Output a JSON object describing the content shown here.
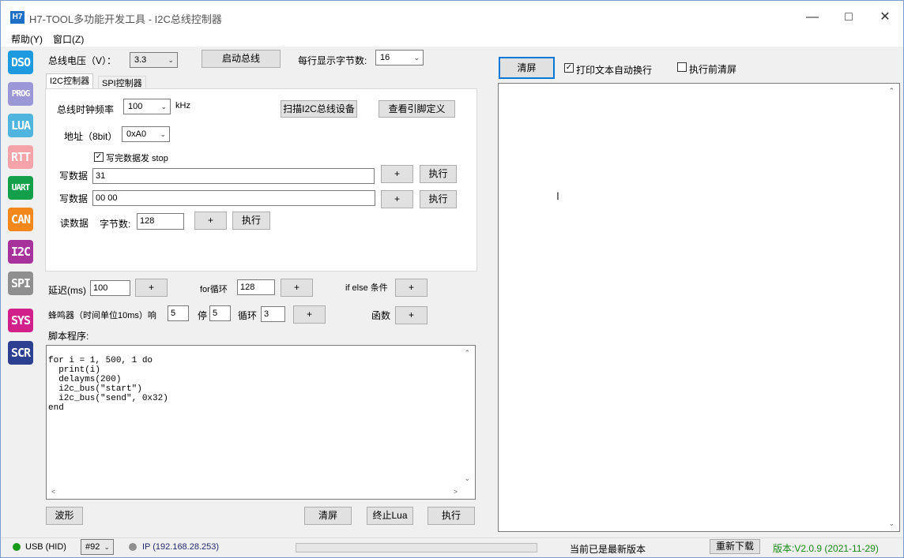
{
  "window": {
    "title": "H7-TOOL多功能开发工具 - I2C总线控制器",
    "icon_text": "H7"
  },
  "menu": {
    "items": [
      "帮助(Y)",
      "窗口(Z)"
    ]
  },
  "sidebar": {
    "items": [
      {
        "label": "DSO",
        "color": "#1e9be0"
      },
      {
        "label": "PROG",
        "color": "#9b96d6"
      },
      {
        "label": "LUA",
        "color": "#4fb4de"
      },
      {
        "label": "RTT",
        "color": "#f4a3a8"
      },
      {
        "label": "UART",
        "color": "#14a04a"
      },
      {
        "label": "CAN",
        "color": "#f2871c"
      },
      {
        "label": "I2C",
        "color": "#a8329c"
      },
      {
        "label": "SPI",
        "color": "#8f8f8f"
      },
      {
        "label": "SYS",
        "color": "#d2208a"
      },
      {
        "label": "SCR",
        "color": "#2c3f90"
      }
    ]
  },
  "top": {
    "voltage_label": "总线电压（V）：",
    "voltage_value": "3.3",
    "start_bus": "启动总线",
    "bytes_per_row_label": "每行显示字节数:",
    "bytes_per_row_value": "16"
  },
  "tabs": [
    "I2C控制器",
    "SPI控制器"
  ],
  "i2c": {
    "clock_label": "总线时钟频率",
    "clock_value": "100",
    "clock_unit": "kHz",
    "scan_button": "扫描I2C总线设备",
    "pin_button": "查看引脚定义",
    "addr_label": "地址（8bit）",
    "addr_value": "0xA0",
    "stop_checkbox": "写完数据发 stop",
    "write1_label": "写数据",
    "write1_value": "31",
    "write2_label": "写数据",
    "write2_value": "00 00",
    "read_label": "读数据",
    "bytes_label": "字节数:",
    "bytes_value": "128",
    "plus": "+",
    "exec": "执行"
  },
  "snippets": {
    "delay_label": "延迟(ms)",
    "delay_value": "100",
    "for_label": "for循环",
    "for_value": "128",
    "ifelse_label": "if else 条件",
    "beep_label": "蜂鸣器（时间单位10ms）响",
    "beep_on": "5",
    "stop_label": "停",
    "beep_off": "5",
    "loop_label": "循环",
    "beep_loop": "3",
    "func_label": "函数",
    "plus": "+"
  },
  "script": {
    "label": "脚本程序:",
    "code": "for i = 1, 500, 1 do\n  print(i)\n  delayms(200)\n  i2c_bus(\"start\")\n  i2c_bus(\"send\", 0x32)\nend"
  },
  "bottom_buttons": {
    "wave": "波形",
    "clear": "清屏",
    "stop_lua": "终止Lua",
    "exec": "执行"
  },
  "output": {
    "clear_button": "清屏",
    "wrap_label": "打印文本自动换行",
    "clear_before_label": "执行前清屏"
  },
  "status": {
    "usb": "USB (HID)",
    "port": "#92",
    "ip": "IP (192.168.28.253)",
    "update_text": "当前已是最新版本",
    "redownload": "重新下载",
    "version": "版本:V2.0.9 (2021-11-29)"
  },
  "colors": {
    "version_text": "#1a8a1a",
    "usb_dot": "#1a9a1a",
    "ip_dot": "#909090"
  }
}
